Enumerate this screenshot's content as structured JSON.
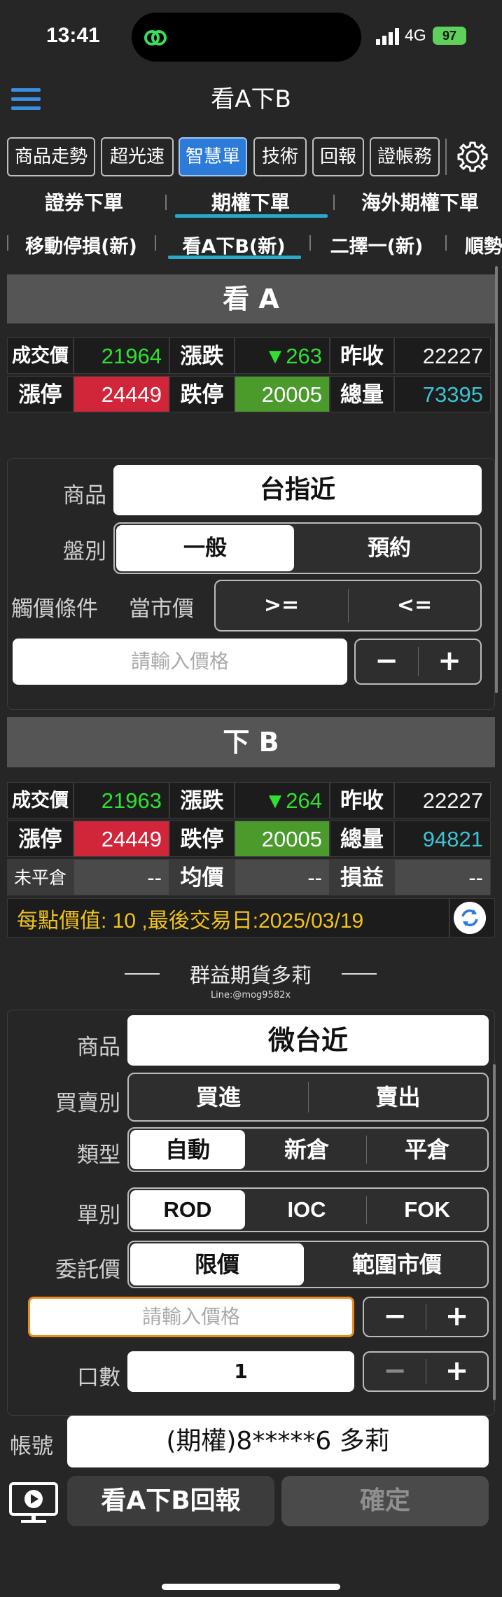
{
  "status": {
    "time": "13:41",
    "network": "4G",
    "battery": "97"
  },
  "header": {
    "title": "看A下B"
  },
  "tabs": [
    "商品走勢",
    "超光速",
    "智慧單",
    "技術",
    "回報",
    "證帳務"
  ],
  "subtabs": [
    "證券下單",
    "期權下單",
    "海外期權下單"
  ],
  "subtabs2": [
    "移動停損(新)",
    "看A下B(新)",
    "二擇一(新)",
    "順勢"
  ],
  "sectionA": {
    "title": "看 A",
    "row1": {
      "l1": "成交價",
      "v1": "21964",
      "l2": "漲跌",
      "v2": "▼263",
      "l3": "昨收",
      "v3": "22227"
    },
    "row2": {
      "l1": "漲停",
      "v1": "24449",
      "l2": "跌停",
      "v2": "20005",
      "l3": "總量",
      "v3": "73395"
    }
  },
  "formA": {
    "product_label": "商品",
    "product": "台指近",
    "type_label": "盤別",
    "type_options": [
      "一般",
      "預約"
    ],
    "trigger_label": "觸價條件",
    "trigger_ref": "當市價",
    "trigger_options": [
      ">=",
      "<="
    ],
    "price_placeholder": "請輸入價格"
  },
  "sectionB": {
    "title": "下 B",
    "row1": {
      "l1": "成交價",
      "v1": "21963",
      "l2": "漲跌",
      "v2": "▼264",
      "l3": "昨收",
      "v3": "22227"
    },
    "row2": {
      "l1": "漲停",
      "v1": "24449",
      "l2": "跌停",
      "v2": "20005",
      "l3": "總量",
      "v3": "94821"
    },
    "row3": {
      "l1": "未平倉",
      "v1": "--",
      "l2": "均價",
      "v2": "--",
      "l3": "損益",
      "v3": "--"
    }
  },
  "info": {
    "text": "每點價值: 10 ,最後交易日:2025/03/19"
  },
  "watermark": {
    "title": "群益期貨多莉",
    "line": "Line:@mog9582x"
  },
  "formB": {
    "product_label": "商品",
    "product": "微台近",
    "side_label": "買賣別",
    "side_options": [
      "買進",
      "賣出"
    ],
    "kind_label": "類型",
    "kind_options": [
      "自動",
      "新倉",
      "平倉"
    ],
    "order_label": "單別",
    "order_options": [
      "ROD",
      "IOC",
      "FOK"
    ],
    "price_label": "委託價",
    "price_options": [
      "限價",
      "範圍市價"
    ],
    "price_placeholder": "請輸入價格",
    "qty_label": "口數",
    "qty": "1",
    "account_label": "帳號",
    "account": "(期權)8*****6  多莉"
  },
  "buttons": {
    "report": "看A下B回報",
    "confirm": "確定"
  }
}
